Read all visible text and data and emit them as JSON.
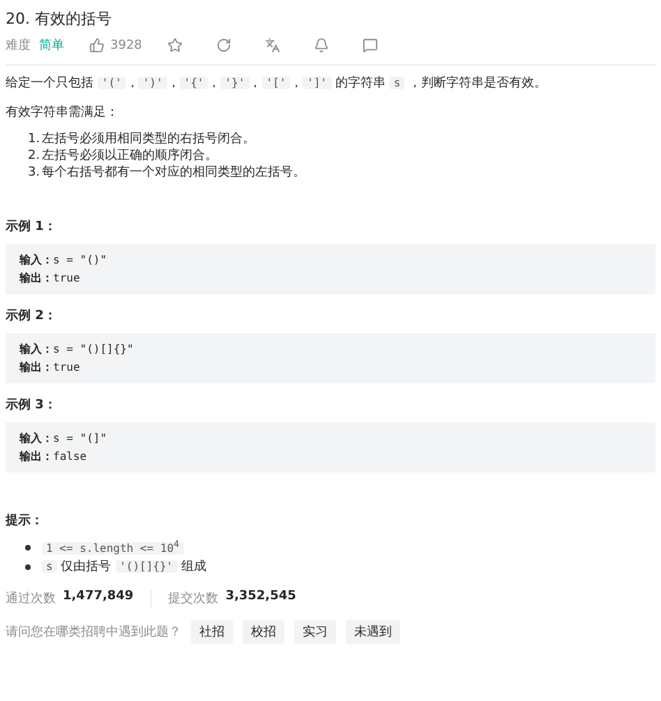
{
  "title": "20. 有效的括号",
  "meta": {
    "difficulty_label": "难度",
    "difficulty": "简单",
    "likes": "3928"
  },
  "intro": [
    {
      "kind": "text",
      "text": "给定一个只包括 "
    },
    {
      "kind": "code",
      "text": "'('"
    },
    {
      "kind": "text",
      "text": "，"
    },
    {
      "kind": "code",
      "text": "')'"
    },
    {
      "kind": "text",
      "text": "，"
    },
    {
      "kind": "code",
      "text": "'{'"
    },
    {
      "kind": "text",
      "text": "，"
    },
    {
      "kind": "code",
      "text": "'}'"
    },
    {
      "kind": "text",
      "text": "，"
    },
    {
      "kind": "code",
      "text": "'['"
    },
    {
      "kind": "text",
      "text": "，"
    },
    {
      "kind": "code",
      "text": "']'"
    },
    {
      "kind": "text",
      "text": " 的字符串 "
    },
    {
      "kind": "code",
      "text": "s"
    },
    {
      "kind": "text",
      "text": " ，判断字符串是否有效。"
    }
  ],
  "rules_heading": "有效字符串需满足：",
  "rules": [
    "左括号必须用相同类型的右括号闭合。",
    "左括号必须以正确的顺序闭合。",
    "每个右括号都有一个对应的相同类型的左括号。"
  ],
  "rule_numbers": [
    "1.",
    "2.",
    "3."
  ],
  "examples": [
    {
      "heading": "示例 1：",
      "input_label": "输入：",
      "input": "s = \"()\"",
      "output_label": "输出：",
      "output": "true"
    },
    {
      "heading": "示例 2：",
      "input_label": "输入：",
      "input": "s = \"()[]{}\"",
      "output_label": "输出：",
      "output": "true"
    },
    {
      "heading": "示例 3：",
      "input_label": "输入：",
      "input": "s = \"(]\"",
      "output_label": "输出：",
      "output": "false"
    }
  ],
  "hints_heading": "提示：",
  "hints": [
    [
      {
        "kind": "code",
        "text": "1 <= s.length <= 10$^{4}$"
      }
    ],
    [
      {
        "kind": "code",
        "text": "s"
      },
      {
        "kind": "text",
        "text": " 仅由括号 "
      },
      {
        "kind": "code",
        "text": "'()[]{}'"
      },
      {
        "kind": "text",
        "text": " 组成"
      }
    ]
  ],
  "stats": [
    {
      "label": "通过次数",
      "value": "1,477,849"
    },
    {
      "label": "提交次数",
      "value": "3,352,545"
    }
  ],
  "survey": {
    "question": "请问您在哪类招聘中遇到此题？",
    "options": [
      "社招",
      "校招",
      "实习",
      "未遇到"
    ]
  }
}
